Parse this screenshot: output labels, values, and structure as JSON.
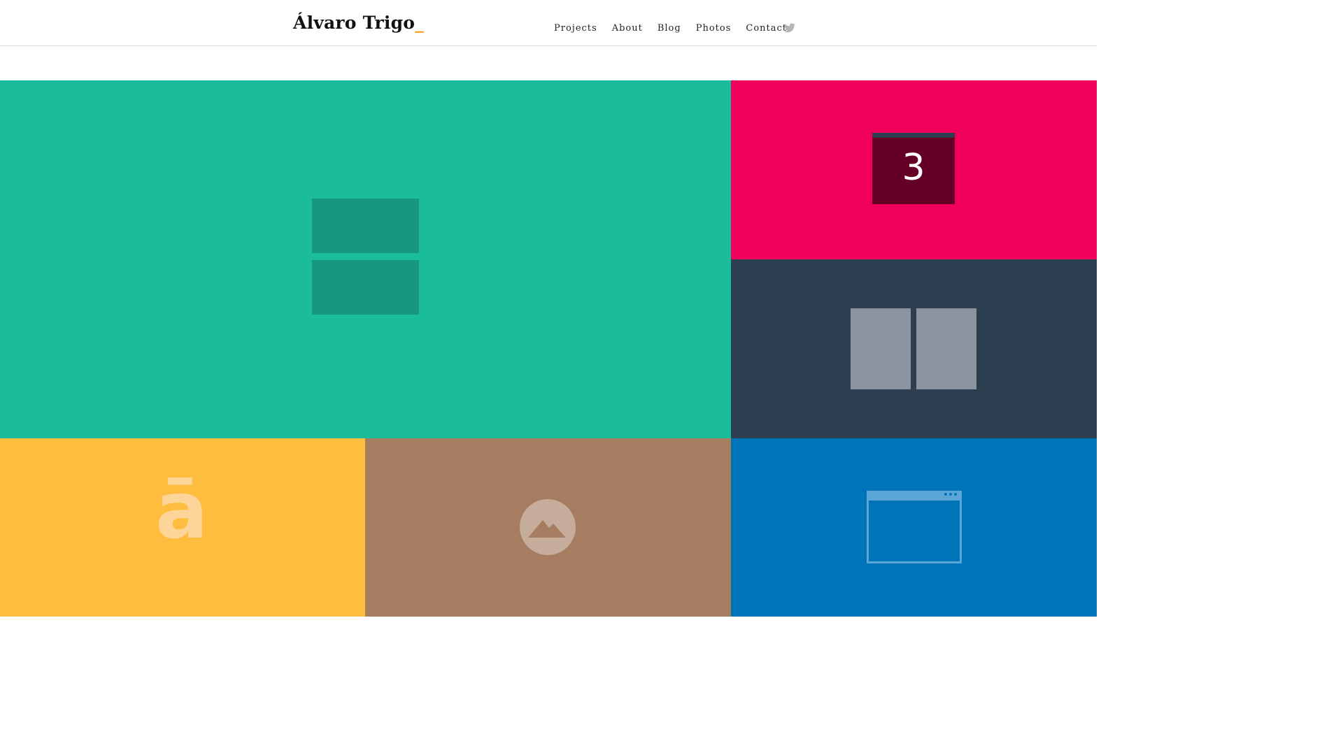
{
  "header": {
    "logo_text": "Álvaro Trigo",
    "logo_accent": "_",
    "nav": [
      "Projects",
      "About",
      "Blog",
      "Photos",
      "Contact"
    ],
    "social_icon": "twitter-icon"
  },
  "tiles": {
    "calendar_number": "3",
    "font_letter": "ā"
  },
  "colors": {
    "green": "#1bbc9b",
    "pink": "#f0005a",
    "navy": "#2d3e50",
    "yellow": "#febd3e",
    "brown": "#a67d60",
    "blue": "#0074b8",
    "accent": "#f5a623"
  }
}
